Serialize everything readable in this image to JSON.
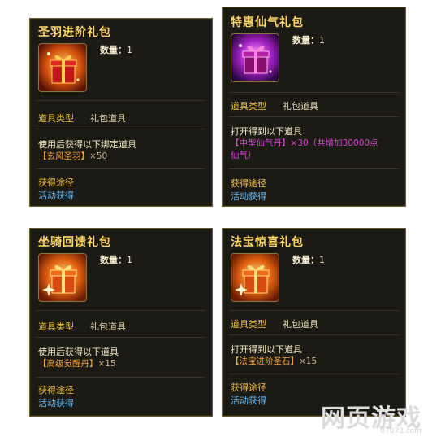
{
  "cards": [
    {
      "title": "圣羽进阶礼包",
      "quantity_label": "数量：",
      "quantity": "1",
      "type_label": "道具类型",
      "type_value": "礼包道具",
      "desc": "使用后获得以下绑定道具",
      "reward": "【玄风圣羽】",
      "reward_times": "×50",
      "get_label": "获得途径",
      "get_value": "活动获得",
      "icon": "red-gift-box-icon"
    },
    {
      "title": "特惠仙气礼包",
      "quantity_label": "数量：",
      "quantity": "1",
      "type_label": "道具类型",
      "type_value": "礼包道具",
      "desc": "打开得到以下道具",
      "reward": "【中型仙气丹】×30（共增加30000点",
      "reward_line2": "仙气）",
      "get_label": "获得途径",
      "get_value": "活动获得",
      "icon": "purple-gift-box-icon"
    },
    {
      "title": "坐骑回馈礼包",
      "quantity_label": "数量：",
      "quantity": "1",
      "type_label": "道具类型",
      "type_value": "礼包道具",
      "desc": "使用后获得以下道具",
      "reward": "【高级觉醒丹】",
      "reward_times": "×15",
      "get_label": "获得途径",
      "get_value": "活动获得",
      "icon": "orange-gift-box-icon"
    },
    {
      "title": "法宝惊喜礼包",
      "quantity_label": "数量：",
      "quantity": "1",
      "type_label": "道具类型",
      "type_value": "礼包道具",
      "desc": "打开得到以下道具",
      "reward": "【法宝进阶圣石】",
      "reward_times": "×15",
      "get_label": "获得途径",
      "get_value": "活动获得",
      "icon": "orange-gift-box-icon"
    }
  ],
  "watermark": {
    "main": "网页游戏",
    "sub": "07073.com"
  },
  "colors": {
    "card_bg": "#1c1a14",
    "title": "#ffd86a",
    "label_gold": "#f0c048",
    "reward_orange": "#f2a23a",
    "reward_magenta": "#d946d9",
    "link_blue": "#5fb5f0"
  }
}
